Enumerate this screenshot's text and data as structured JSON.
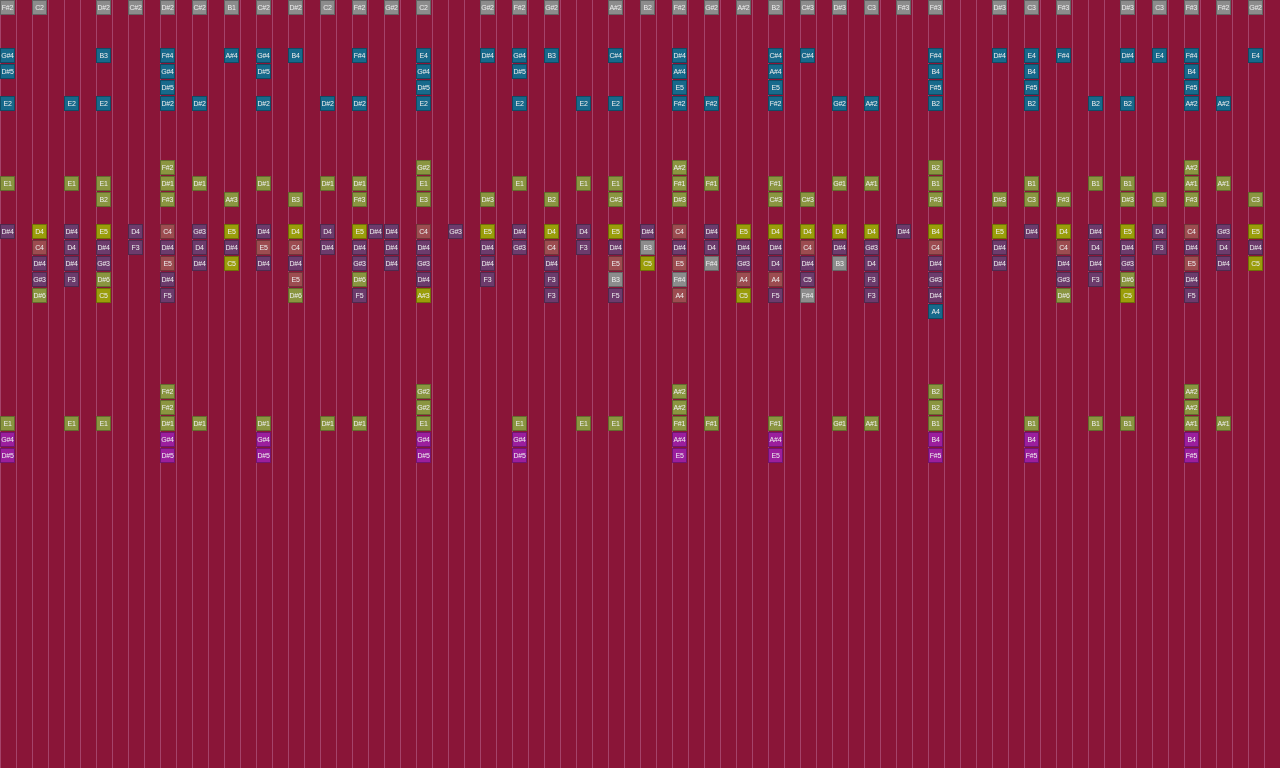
{
  "grid": {
    "columns": [
      {
        "notes": [
          {
            "label": "F#2",
            "color": "#8c8c8c"
          },
          {
            "label": "G#4",
            "color": "#17698b"
          },
          {
            "label": "D#5",
            "color": "#17698b"
          },
          {
            "label": "E2",
            "color": "#17698b"
          },
          {
            "label": "E1",
            "color": "#8a9540"
          },
          {
            "label": "D#4",
            "color": "#6c3b6c"
          },
          {
            "label": "E1",
            "color": "#8a9540"
          },
          {
            "label": "G#4",
            "color": "#9b1e9d"
          },
          {
            "label": "D#5",
            "color": "#9b1e9d"
          }
        ]
      },
      {
        "notes": [
          {
            "label": "C2",
            "color": "#8c8c8c"
          },
          {
            "label": "D4",
            "color": "#9a9d0a"
          },
          {
            "label": "C4",
            "color": "#9c4c50"
          },
          {
            "label": "D#4",
            "color": "#6c3b6c"
          },
          {
            "label": "G#3",
            "color": "#6c3b6c"
          },
          {
            "label": "D#6",
            "color": "#8a9540"
          }
        ]
      },
      {
        "notes": [
          {
            "label": "E2",
            "color": "#17698b"
          },
          {
            "label": "E1",
            "color": "#8a9540"
          },
          {
            "label": "D#4",
            "color": "#6c3b6c"
          },
          {
            "label": "D4",
            "color": "#6c3b6c"
          },
          {
            "label": "D#4",
            "color": "#6c3b6c"
          },
          {
            "label": "F3",
            "color": "#6c3b6c"
          },
          {
            "label": "E1",
            "color": "#8a9540"
          }
        ]
      },
      {
        "notes": [
          {
            "label": "D#2",
            "color": "#8c8c8c"
          },
          {
            "label": "B3",
            "color": "#17698b"
          },
          {
            "label": "E2",
            "color": "#17698b"
          },
          {
            "label": "E1",
            "color": "#8a9540"
          },
          {
            "label": "B2",
            "color": "#8a9540"
          },
          {
            "label": "E5",
            "color": "#9a9d0a"
          },
          {
            "label": "D#4",
            "color": "#6c3b6c"
          },
          {
            "label": "G#3",
            "color": "#6c3b6c"
          },
          {
            "label": "D#6",
            "color": "#8a9540"
          },
          {
            "label": "C5",
            "color": "#9a9d0a"
          },
          {
            "label": "E1",
            "color": "#8a9540"
          }
        ]
      },
      {
        "notes": [
          {
            "label": "C#2",
            "color": "#8c8c8c"
          },
          {
            "label": "D4",
            "color": "#6c3b6c"
          },
          {
            "label": "F3",
            "color": "#6c3b6c"
          }
        ]
      },
      {
        "notes": [
          {
            "label": "D#2",
            "color": "#8c8c8c"
          },
          {
            "label": "F#4",
            "color": "#17698b"
          },
          {
            "label": "G#4",
            "color": "#17698b"
          },
          {
            "label": "D#5",
            "color": "#17698b"
          },
          {
            "label": "D#2",
            "color": "#17698b"
          },
          {
            "label": "F#2",
            "color": "#8a9540"
          },
          {
            "label": "D#1",
            "color": "#8a9540"
          },
          {
            "label": "F#3",
            "color": "#8a9540"
          },
          {
            "label": "C4",
            "color": "#9c4c50"
          },
          {
            "label": "D#4",
            "color": "#6c3b6c"
          },
          {
            "label": "E5",
            "color": "#9c4c50"
          },
          {
            "label": "D#4",
            "color": "#6c3b6c"
          },
          {
            "label": "F5",
            "color": "#6c3b6c"
          },
          {
            "label": "F#2",
            "color": "#8a9540"
          },
          {
            "label": "F#2",
            "color": "#8a9540"
          },
          {
            "label": "D#1",
            "color": "#8a9540"
          },
          {
            "label": "G#4",
            "color": "#9b1e9d"
          },
          {
            "label": "D#5",
            "color": "#9b1e9d"
          }
        ]
      },
      {
        "notes": [
          {
            "label": "C#2",
            "color": "#8c8c8c"
          },
          {
            "label": "D#2",
            "color": "#17698b"
          },
          {
            "label": "D#1",
            "color": "#8a9540"
          },
          {
            "label": "G#3",
            "color": "#6c3b6c"
          },
          {
            "label": "D4",
            "color": "#6c3b6c"
          },
          {
            "label": "D#4",
            "color": "#6c3b6c"
          },
          {
            "label": "D#1",
            "color": "#8a9540"
          }
        ]
      },
      {
        "notes": [
          {
            "label": "B1",
            "color": "#8c8c8c"
          },
          {
            "label": "A#4",
            "color": "#17698b"
          },
          {
            "label": "A#3",
            "color": "#8a9540"
          },
          {
            "label": "E5",
            "color": "#9a9d0a"
          },
          {
            "label": "D#4",
            "color": "#6c3b6c"
          },
          {
            "label": "C5",
            "color": "#9a9d0a"
          }
        ]
      },
      {
        "notes": [
          {
            "label": "C#2",
            "color": "#8c8c8c"
          },
          {
            "label": "G#4",
            "color": "#17698b"
          },
          {
            "label": "D#5",
            "color": "#17698b"
          },
          {
            "label": "D#2",
            "color": "#17698b"
          },
          {
            "label": "D#1",
            "color": "#8a9540"
          },
          {
            "label": "D#4",
            "color": "#6c3b6c"
          },
          {
            "label": "E5",
            "color": "#9c4c50"
          },
          {
            "label": "D#4",
            "color": "#6c3b6c"
          },
          {
            "label": "D#1",
            "color": "#8a9540"
          },
          {
            "label": "G#4",
            "color": "#9b1e9d"
          },
          {
            "label": "D#5",
            "color": "#9b1e9d"
          }
        ]
      },
      {
        "notes": [
          {
            "label": "D#2",
            "color": "#8c8c8c"
          },
          {
            "label": "B4",
            "color": "#17698b"
          },
          {
            "label": "B3",
            "color": "#8a9540"
          },
          {
            "label": "D4",
            "color": "#9a9d0a"
          },
          {
            "label": "C4",
            "color": "#9c4c50"
          },
          {
            "label": "D#4",
            "color": "#6c3b6c"
          },
          {
            "label": "E5",
            "color": "#9c4c50"
          },
          {
            "label": "D#6",
            "color": "#8a9540"
          }
        ]
      },
      {
        "notes": [
          {
            "label": "C2",
            "color": "#8c8c8c"
          },
          {
            "label": "D#2",
            "color": "#17698b"
          },
          {
            "label": "D#1",
            "color": "#8a9540"
          },
          {
            "label": "D4",
            "color": "#6c3b6c"
          },
          {
            "label": "D#4",
            "color": "#6c3b6c"
          },
          {
            "label": "D#1",
            "color": "#8a9540"
          }
        ]
      },
      {
        "notes": [
          {
            "label": "F#2",
            "color": "#8c8c8c"
          },
          {
            "label": "F#4",
            "color": "#17698b"
          },
          {
            "label": "D#2",
            "color": "#17698b"
          },
          {
            "label": "D#1",
            "color": "#8a9540"
          },
          {
            "label": "F#3",
            "color": "#8a9540"
          },
          {
            "label": "E5",
            "color": "#9a9d0a"
          },
          {
            "label": "D#4",
            "color": "#6c3b6c"
          },
          {
            "label": "G#3",
            "color": "#6c3b6c"
          },
          {
            "label": "D#6",
            "color": "#8a9540"
          },
          {
            "label": "F5",
            "color": "#6c3b6c"
          },
          {
            "label": "D#1",
            "color": "#8a9540"
          }
        ]
      },
      {
        "notes": [
          {
            "label": "D#4",
            "color": "#6c3b6c"
          }
        ]
      },
      {
        "notes": [
          {
            "label": "G#2",
            "color": "#8c8c8c"
          },
          {
            "label": "D#4",
            "color": "#6c3b6c"
          },
          {
            "label": "D#4",
            "color": "#6c3b6c"
          },
          {
            "label": "D#4",
            "color": "#6c3b6c"
          }
        ]
      },
      {
        "notes": [
          {
            "label": "C2",
            "color": "#8c8c8c"
          },
          {
            "label": "E4",
            "color": "#17698b"
          },
          {
            "label": "G#4",
            "color": "#17698b"
          },
          {
            "label": "D#5",
            "color": "#17698b"
          },
          {
            "label": "E2",
            "color": "#17698b"
          },
          {
            "label": "G#2",
            "color": "#8a9540"
          },
          {
            "label": "E1",
            "color": "#8a9540"
          },
          {
            "label": "E3",
            "color": "#8a9540"
          },
          {
            "label": "C4",
            "color": "#9c4c50"
          },
          {
            "label": "D#4",
            "color": "#6c3b6c"
          },
          {
            "label": "G#3",
            "color": "#6c3b6c"
          },
          {
            "label": "D#4",
            "color": "#6c3b6c"
          },
          {
            "label": "A#3",
            "color": "#9a9d0a"
          },
          {
            "label": "G#2",
            "color": "#8a9540"
          },
          {
            "label": "G#2",
            "color": "#8a9540"
          },
          {
            "label": "E1",
            "color": "#8a9540"
          },
          {
            "label": "G#4",
            "color": "#9b1e9d"
          },
          {
            "label": "D#5",
            "color": "#9b1e9d"
          }
        ]
      },
      {
        "notes": [
          {
            "label": "G#3",
            "color": "#6c3b6c"
          }
        ]
      },
      {
        "notes": [
          {
            "label": "G#2",
            "color": "#8c8c8c"
          },
          {
            "label": "D#4",
            "color": "#17698b"
          },
          {
            "label": "D#3",
            "color": "#8a9540"
          },
          {
            "label": "E5",
            "color": "#9a9d0a"
          },
          {
            "label": "D#4",
            "color": "#6c3b6c"
          },
          {
            "label": "D#4",
            "color": "#6c3b6c"
          },
          {
            "label": "F3",
            "color": "#6c3b6c"
          }
        ]
      },
      {
        "notes": [
          {
            "label": "F#2",
            "color": "#8c8c8c"
          },
          {
            "label": "G#4",
            "color": "#17698b"
          },
          {
            "label": "D#5",
            "color": "#17698b"
          },
          {
            "label": "E2",
            "color": "#17698b"
          },
          {
            "label": "E1",
            "color": "#8a9540"
          },
          {
            "label": "D#4",
            "color": "#6c3b6c"
          },
          {
            "label": "G#3",
            "color": "#6c3b6c"
          },
          {
            "label": "E1",
            "color": "#8a9540"
          },
          {
            "label": "G#4",
            "color": "#9b1e9d"
          },
          {
            "label": "D#5",
            "color": "#9b1e9d"
          }
        ]
      },
      {
        "notes": [
          {
            "label": "G#2",
            "color": "#8c8c8c"
          },
          {
            "label": "B3",
            "color": "#17698b"
          },
          {
            "label": "B2",
            "color": "#8a9540"
          },
          {
            "label": "D4",
            "color": "#9a9d0a"
          },
          {
            "label": "C4",
            "color": "#9c4c50"
          },
          {
            "label": "D#4",
            "color": "#6c3b6c"
          },
          {
            "label": "F3",
            "color": "#6c3b6c"
          },
          {
            "label": "F3",
            "color": "#6c3b6c"
          }
        ]
      },
      {
        "notes": [
          {
            "label": "E2",
            "color": "#17698b"
          },
          {
            "label": "E1",
            "color": "#8a9540"
          },
          {
            "label": "D4",
            "color": "#6c3b6c"
          },
          {
            "label": "F3",
            "color": "#6c3b6c"
          },
          {
            "label": "E1",
            "color": "#8a9540"
          }
        ]
      },
      {
        "notes": [
          {
            "label": "A#2",
            "color": "#8c8c8c"
          },
          {
            "label": "C#4",
            "color": "#17698b"
          },
          {
            "label": "E2",
            "color": "#17698b"
          },
          {
            "label": "E1",
            "color": "#8a9540"
          },
          {
            "label": "C#3",
            "color": "#8a9540"
          },
          {
            "label": "E5",
            "color": "#9a9d0a"
          },
          {
            "label": "D#4",
            "color": "#6c3b6c"
          },
          {
            "label": "E5",
            "color": "#9c4c50"
          },
          {
            "label": "B3",
            "color": "#8c8c8c"
          },
          {
            "label": "F5",
            "color": "#6c3b6c"
          },
          {
            "label": "E1",
            "color": "#8a9540"
          }
        ]
      },
      {
        "notes": [
          {
            "label": "B2",
            "color": "#8c8c8c"
          },
          {
            "label": "D#4",
            "color": "#6c3b6c"
          },
          {
            "label": "B3",
            "color": "#8c8c8c"
          },
          {
            "label": "C5",
            "color": "#9a9d0a"
          }
        ]
      },
      {
        "notes": [
          {
            "label": "F#2",
            "color": "#8c8c8c"
          },
          {
            "label": "D#4",
            "color": "#17698b"
          },
          {
            "label": "A#4",
            "color": "#17698b"
          },
          {
            "label": "E5",
            "color": "#17698b"
          },
          {
            "label": "F#2",
            "color": "#17698b"
          },
          {
            "label": "A#2",
            "color": "#8a9540"
          },
          {
            "label": "F#1",
            "color": "#8a9540"
          },
          {
            "label": "D#3",
            "color": "#8a9540"
          },
          {
            "label": "C4",
            "color": "#9c4c50"
          },
          {
            "label": "D#4",
            "color": "#6c3b6c"
          },
          {
            "label": "E5",
            "color": "#9c4c50"
          },
          {
            "label": "F#4",
            "color": "#8c8c8c"
          },
          {
            "label": "A4",
            "color": "#9c4c50"
          },
          {
            "label": "A#2",
            "color": "#8a9540"
          },
          {
            "label": "A#2",
            "color": "#8a9540"
          },
          {
            "label": "F#1",
            "color": "#8a9540"
          },
          {
            "label": "A#4",
            "color": "#9b1e9d"
          },
          {
            "label": "E5",
            "color": "#9b1e9d"
          }
        ]
      },
      {
        "notes": [
          {
            "label": "G#2",
            "color": "#8c8c8c"
          },
          {
            "label": "F#2",
            "color": "#17698b"
          },
          {
            "label": "F#1",
            "color": "#8a9540"
          },
          {
            "label": "D#4",
            "color": "#6c3b6c"
          },
          {
            "label": "D4",
            "color": "#6c3b6c"
          },
          {
            "label": "F#4",
            "color": "#8c8c8c"
          },
          {
            "label": "F#1",
            "color": "#8a9540"
          }
        ]
      },
      {
        "notes": [
          {
            "label": "A#2",
            "color": "#8c8c8c"
          },
          {
            "label": "E5",
            "color": "#9a9d0a"
          },
          {
            "label": "D#4",
            "color": "#6c3b6c"
          },
          {
            "label": "G#3",
            "color": "#6c3b6c"
          },
          {
            "label": "A4",
            "color": "#9c4c50"
          },
          {
            "label": "C5",
            "color": "#9a9d0a"
          }
        ]
      },
      {
        "notes": [
          {
            "label": "B2",
            "color": "#8c8c8c"
          },
          {
            "label": "C#4",
            "color": "#17698b"
          },
          {
            "label": "A#4",
            "color": "#17698b"
          },
          {
            "label": "E5",
            "color": "#17698b"
          },
          {
            "label": "F#2",
            "color": "#17698b"
          },
          {
            "label": "F#1",
            "color": "#8a9540"
          },
          {
            "label": "C#3",
            "color": "#8a9540"
          },
          {
            "label": "D4",
            "color": "#9a9d0a"
          },
          {
            "label": "D#4",
            "color": "#6c3b6c"
          },
          {
            "label": "D4",
            "color": "#6c3b6c"
          },
          {
            "label": "A4",
            "color": "#9c4c50"
          },
          {
            "label": "F5",
            "color": "#6c3b6c"
          },
          {
            "label": "F#1",
            "color": "#8a9540"
          },
          {
            "label": "A#4",
            "color": "#9b1e9d"
          },
          {
            "label": "E5",
            "color": "#9b1e9d"
          }
        ]
      },
      {
        "notes": [
          {
            "label": "C#3",
            "color": "#8c8c8c"
          },
          {
            "label": "C#4",
            "color": "#17698b"
          },
          {
            "label": "C#3",
            "color": "#8a9540"
          },
          {
            "label": "D4",
            "color": "#9a9d0a"
          },
          {
            "label": "C4",
            "color": "#9c4c50"
          },
          {
            "label": "D#4",
            "color": "#6c3b6c"
          },
          {
            "label": "C5",
            "color": "#6c3b6c"
          },
          {
            "label": "F#4",
            "color": "#8c8c8c"
          }
        ]
      },
      {
        "notes": [
          {
            "label": "D#3",
            "color": "#8c8c8c"
          },
          {
            "label": "G#2",
            "color": "#17698b"
          },
          {
            "label": "G#1",
            "color": "#8a9540"
          },
          {
            "label": "D4",
            "color": "#9a9d0a"
          },
          {
            "label": "D#4",
            "color": "#6c3b6c"
          },
          {
            "label": "B3",
            "color": "#8c8c8c"
          },
          {
            "label": "G#1",
            "color": "#8a9540"
          }
        ]
      },
      {
        "notes": [
          {
            "label": "C3",
            "color": "#8c8c8c"
          },
          {
            "label": "A#2",
            "color": "#17698b"
          },
          {
            "label": "A#1",
            "color": "#8a9540"
          },
          {
            "label": "D4",
            "color": "#9a9d0a"
          },
          {
            "label": "G#3",
            "color": "#6c3b6c"
          },
          {
            "label": "D4",
            "color": "#6c3b6c"
          },
          {
            "label": "F3",
            "color": "#6c3b6c"
          },
          {
            "label": "F3",
            "color": "#6c3b6c"
          },
          {
            "label": "A#1",
            "color": "#8a9540"
          }
        ]
      },
      {
        "notes": [
          {
            "label": "F#3",
            "color": "#8c8c8c"
          },
          {
            "label": "D#4",
            "color": "#6c3b6c"
          }
        ]
      },
      {
        "notes": [
          {
            "label": "F#3",
            "color": "#8c8c8c"
          },
          {
            "label": "F#4",
            "color": "#17698b"
          },
          {
            "label": "B4",
            "color": "#17698b"
          },
          {
            "label": "F#5",
            "color": "#17698b"
          },
          {
            "label": "B2",
            "color": "#17698b"
          },
          {
            "label": "B2",
            "color": "#8a9540"
          },
          {
            "label": "B1",
            "color": "#8a9540"
          },
          {
            "label": "F#3",
            "color": "#8a9540"
          },
          {
            "label": "B4",
            "color": "#9a9d0a"
          },
          {
            "label": "C4",
            "color": "#9c4c50"
          },
          {
            "label": "D#4",
            "color": "#6c3b6c"
          },
          {
            "label": "G#3",
            "color": "#6c3b6c"
          },
          {
            "label": "D#4",
            "color": "#6c3b6c"
          },
          {
            "label": "A4",
            "color": "#17698b"
          },
          {
            "label": "B2",
            "color": "#8a9540"
          },
          {
            "label": "B2",
            "color": "#8a9540"
          },
          {
            "label": "B1",
            "color": "#8a9540"
          },
          {
            "label": "B4",
            "color": "#9b1e9d"
          },
          {
            "label": "F#5",
            "color": "#9b1e9d"
          }
        ]
      },
      {
        "notes": [
          {
            "label": "D#3",
            "color": "#8c8c8c"
          },
          {
            "label": "D#4",
            "color": "#17698b"
          },
          {
            "label": "D#3",
            "color": "#8a9540"
          },
          {
            "label": "E5",
            "color": "#9a9d0a"
          },
          {
            "label": "D#4",
            "color": "#6c3b6c"
          },
          {
            "label": "D#4",
            "color": "#6c3b6c"
          }
        ]
      },
      {
        "notes": [
          {
            "label": "C3",
            "color": "#8c8c8c"
          },
          {
            "label": "E4",
            "color": "#17698b"
          },
          {
            "label": "B4",
            "color": "#17698b"
          },
          {
            "label": "F#5",
            "color": "#17698b"
          },
          {
            "label": "B2",
            "color": "#17698b"
          },
          {
            "label": "B1",
            "color": "#8a9540"
          },
          {
            "label": "C3",
            "color": "#8a9540"
          },
          {
            "label": "D#4",
            "color": "#6c3b6c"
          },
          {
            "label": "B1",
            "color": "#8a9540"
          },
          {
            "label": "B4",
            "color": "#9b1e9d"
          },
          {
            "label": "F#5",
            "color": "#9b1e9d"
          }
        ]
      },
      {
        "notes": [
          {
            "label": "F#3",
            "color": "#8c8c8c"
          },
          {
            "label": "F#4",
            "color": "#17698b"
          },
          {
            "label": "F#3",
            "color": "#8a9540"
          },
          {
            "label": "D4",
            "color": "#9a9d0a"
          },
          {
            "label": "C4",
            "color": "#9c4c50"
          },
          {
            "label": "D#4",
            "color": "#6c3b6c"
          },
          {
            "label": "G#3",
            "color": "#6c3b6c"
          },
          {
            "label": "D#6",
            "color": "#8a9540"
          }
        ]
      },
      {
        "notes": [
          {
            "label": "B2",
            "color": "#17698b"
          },
          {
            "label": "B1",
            "color": "#8a9540"
          },
          {
            "label": "D#4",
            "color": "#6c3b6c"
          },
          {
            "label": "D4",
            "color": "#6c3b6c"
          },
          {
            "label": "D#4",
            "color": "#6c3b6c"
          },
          {
            "label": "F3",
            "color": "#6c3b6c"
          },
          {
            "label": "B1",
            "color": "#8a9540"
          }
        ]
      },
      {
        "notes": [
          {
            "label": "D#3",
            "color": "#8c8c8c"
          },
          {
            "label": "D#4",
            "color": "#17698b"
          },
          {
            "label": "B2",
            "color": "#17698b"
          },
          {
            "label": "B1",
            "color": "#8a9540"
          },
          {
            "label": "D#3",
            "color": "#8a9540"
          },
          {
            "label": "E5",
            "color": "#9a9d0a"
          },
          {
            "label": "D#4",
            "color": "#6c3b6c"
          },
          {
            "label": "G#3",
            "color": "#6c3b6c"
          },
          {
            "label": "D#6",
            "color": "#8a9540"
          },
          {
            "label": "C5",
            "color": "#9a9d0a"
          },
          {
            "label": "B1",
            "color": "#8a9540"
          }
        ]
      },
      {
        "notes": [
          {
            "label": "C3",
            "color": "#8c8c8c"
          },
          {
            "label": "E4",
            "color": "#17698b"
          },
          {
            "label": "C3",
            "color": "#8a9540"
          },
          {
            "label": "D4",
            "color": "#6c3b6c"
          },
          {
            "label": "F3",
            "color": "#6c3b6c"
          }
        ]
      },
      {
        "notes": [
          {
            "label": "F#3",
            "color": "#8c8c8c"
          },
          {
            "label": "F#4",
            "color": "#17698b"
          },
          {
            "label": "B4",
            "color": "#17698b"
          },
          {
            "label": "F#5",
            "color": "#17698b"
          },
          {
            "label": "A#2",
            "color": "#17698b"
          },
          {
            "label": "A#2",
            "color": "#8a9540"
          },
          {
            "label": "A#1",
            "color": "#8a9540"
          },
          {
            "label": "F#3",
            "color": "#8a9540"
          },
          {
            "label": "C4",
            "color": "#9c4c50"
          },
          {
            "label": "D#4",
            "color": "#6c3b6c"
          },
          {
            "label": "E5",
            "color": "#9c4c50"
          },
          {
            "label": "D#4",
            "color": "#6c3b6c"
          },
          {
            "label": "F5",
            "color": "#6c3b6c"
          },
          {
            "label": "A#2",
            "color": "#8a9540"
          },
          {
            "label": "A#2",
            "color": "#8a9540"
          },
          {
            "label": "A#1",
            "color": "#8a9540"
          },
          {
            "label": "B4",
            "color": "#9b1e9d"
          },
          {
            "label": "F#5",
            "color": "#9b1e9d"
          }
        ]
      },
      {
        "notes": [
          {
            "label": "F#2",
            "color": "#8c8c8c"
          },
          {
            "label": "A#2",
            "color": "#17698b"
          },
          {
            "label": "A#1",
            "color": "#8a9540"
          },
          {
            "label": "G#3",
            "color": "#6c3b6c"
          },
          {
            "label": "D4",
            "color": "#6c3b6c"
          },
          {
            "label": "D#4",
            "color": "#6c3b6c"
          },
          {
            "label": "A#1",
            "color": "#8a9540"
          }
        ]
      },
      {
        "notes": [
          {
            "label": "G#2",
            "color": "#8c8c8c"
          },
          {
            "label": "E4",
            "color": "#17698b"
          },
          {
            "label": "C3",
            "color": "#8a9540"
          },
          {
            "label": "E5",
            "color": "#9a9d0a"
          },
          {
            "label": "D#4",
            "color": "#6c3b6c"
          },
          {
            "label": "C5",
            "color": "#9a9d0a"
          }
        ]
      }
    ]
  }
}
